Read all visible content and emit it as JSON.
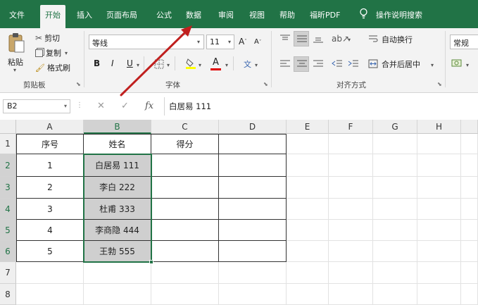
{
  "tabs": [
    {
      "label": "文件",
      "active": false
    },
    {
      "label": "开始",
      "active": true
    },
    {
      "label": "插入",
      "active": false
    },
    {
      "label": "页面布局",
      "active": false
    },
    {
      "label": "公式",
      "active": false
    },
    {
      "label": "数据",
      "active": false
    },
    {
      "label": "审阅",
      "active": false
    },
    {
      "label": "视图",
      "active": false
    },
    {
      "label": "帮助",
      "active": false
    },
    {
      "label": "福昕PDF",
      "active": false
    }
  ],
  "tell_me": "操作说明搜索",
  "ribbon": {
    "clipboard": {
      "paste": "粘贴",
      "cut": "剪切",
      "copy": "复制",
      "format_painter": "格式刷",
      "label": "剪贴板"
    },
    "font": {
      "name": "等线",
      "size": "11",
      "grow": "A",
      "shrink": "A",
      "bold": "B",
      "italic": "I",
      "underline": "U",
      "font_color": "A",
      "phonetic": "文",
      "label": "字体"
    },
    "alignment": {
      "wrap": "自动换行",
      "merge": "合并后居中",
      "label": "对齐方式"
    },
    "number": {
      "format": "常规"
    }
  },
  "formula_bar": {
    "name_box": "B2",
    "cancel": "✕",
    "enter": "✓",
    "fx": "fx",
    "content": "白居易 111"
  },
  "grid": {
    "columns": [
      "A",
      "B",
      "C",
      "D",
      "E",
      "F",
      "G",
      "H"
    ],
    "rows": [
      "1",
      "2",
      "3",
      "4",
      "5",
      "6",
      "7",
      "8"
    ],
    "headers": [
      "序号",
      "姓名",
      "得分"
    ],
    "data": [
      [
        "1",
        "白居易 111",
        ""
      ],
      [
        "2",
        "李白 222",
        ""
      ],
      [
        "3",
        "杜甫 333",
        ""
      ],
      [
        "4",
        "李商隐 444",
        ""
      ],
      [
        "5",
        "王勃 555",
        ""
      ]
    ],
    "selected_column": "B",
    "selected_rows": [
      "2",
      "3",
      "4",
      "5",
      "6"
    ]
  },
  "colors": {
    "accent": "#217346",
    "arrow": "#c0201f"
  }
}
